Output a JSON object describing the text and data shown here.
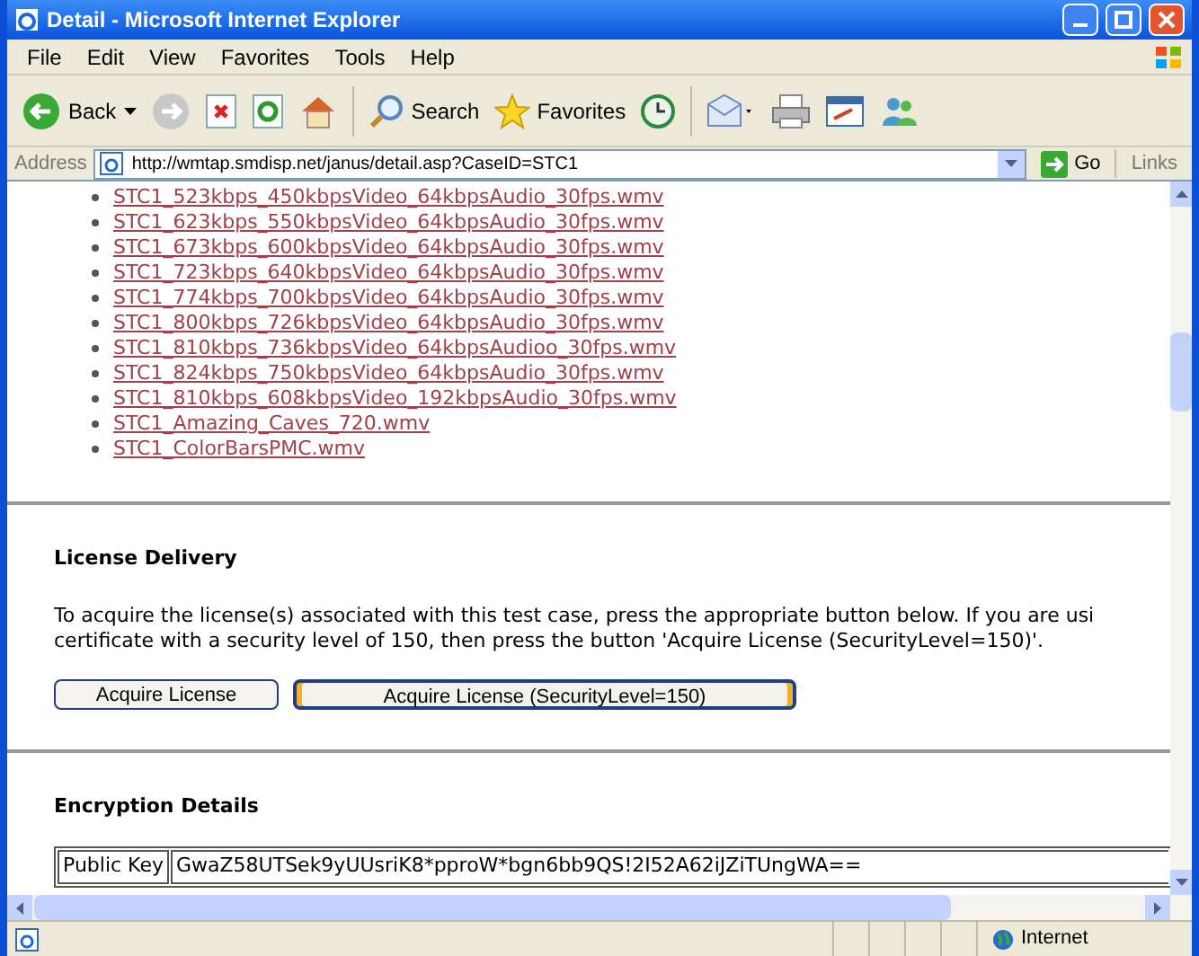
{
  "window": {
    "title": "Detail - Microsoft Internet Explorer"
  },
  "menu": [
    "File",
    "Edit",
    "View",
    "Favorites",
    "Tools",
    "Help"
  ],
  "toolbar": {
    "back": "Back",
    "search": "Search",
    "favorites": "Favorites"
  },
  "address_bar": {
    "label": "Address",
    "url": "http://wmtap.smdisp.net/janus/detail.asp?CaseID=STC1",
    "go": "Go",
    "links": "Links"
  },
  "files": [
    "STC1_523kbps_450kbpsVideo_64kbpsAudio_30fps.wmv",
    "STC1_623kbps_550kbpsVideo_64kbpsAudio_30fps.wmv",
    "STC1_673kbps_600kbpsVideo_64kbpsAudio_30fps.wmv",
    "STC1_723kbps_640kbpsVideo_64kbpsAudio_30fps.wmv",
    "STC1_774kbps_700kbpsVideo_64kbpsAudio_30fps.wmv",
    "STC1_800kbps_726kbpsVideo_64kbpsAudio_30fps.wmv",
    "STC1_810kbps_736kbpsVideo_64kbpsAudioo_30fps.wmv",
    "STC1_824kbps_750kbpsVideo_64kbpsAudio_30fps.wmv",
    "STC1_810kbps_608kbpsVideo_192kbpsAudio_30fps.wmv",
    "STC1_Amazing_Caves_720.wmv",
    "STC1_ColorBarsPMC.wmv"
  ],
  "license": {
    "heading": "License Delivery",
    "text_lines": [
      "To acquire the license(s) associated with this test case, press the appropriate button below. If you are usi",
      "certificate with a security level of 150, then press the button 'Acquire License (SecurityLevel=150)'."
    ],
    "buttons": [
      {
        "label": "Acquire License",
        "focused": false
      },
      {
        "label": "Acquire License (SecurityLevel=150)",
        "focused": true
      }
    ]
  },
  "encryption": {
    "heading": "Encryption Details",
    "rows": [
      {
        "label": "Public Key",
        "value": "GwaZ58UTSek9yUUsriK8*pproW*bgn6bb9QS!2I52A62iJZiTUngWA=="
      }
    ]
  },
  "status_bar": {
    "zone": "Internet"
  }
}
